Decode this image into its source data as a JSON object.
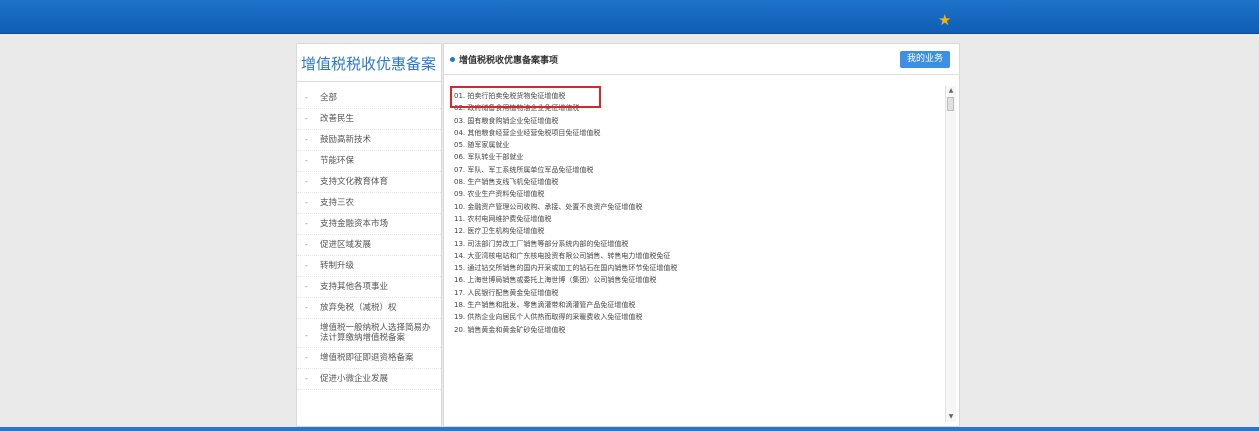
{
  "topbar": {
    "star_icon": "star-icon",
    "accent": "#1e72c8"
  },
  "left_panel": {
    "title": "增值税税收优惠备案",
    "items": [
      "全部",
      "改善民生",
      "鼓励高新技术",
      "节能环保",
      "支持文化教育体育",
      "支持三农",
      "支持金融资本市场",
      "促进区域发展",
      "转制升级",
      "支持其他各项事业",
      "放弃免税（减税）权",
      "增值税一般纳税人选择简易办法计算缴纳增值税备案",
      "增值税即征即退资格备案",
      "促进小微企业发展"
    ]
  },
  "right_panel": {
    "title": "增值税税收优惠备案事项",
    "my_business_label": "我的业务",
    "items": [
      "01. 拍卖行拍卖免税货物免征增值税",
      "02. 政府储备食用植物油企业免征增值税",
      "03. 国有粮食购销企业免征增值税",
      "04. 其他粮食经营企业经营免税项目免征增值税",
      "05. 随军家属就业",
      "06. 军队转业干部就业",
      "07. 军队、军工系统所属单位军品免征增值税",
      "08. 生产销售支线飞机免征增值税",
      "09. 农业生产资料免征增值税",
      "10. 金融资产管理公司收购、承接、处置不良资产免征增值税",
      "11. 农村电网维护费免征增值税",
      "12. 医疗卫生机构免征增值税",
      "13. 司法部门劳改工厂销售等部分系统内部的免征增值税",
      "14. 大亚湾核电站和广东核电投资有限公司销售、转售电力增值税免征",
      "15. 通过钻交所销售的国内开采或加工的钻石在国内销售环节免征增值税",
      "16. 上海世博局销售或委托上海世博（集团）公司销售免征增值税",
      "17. 人民银行配售黄金免征增值税",
      "18. 生产销售和批发、零售滴灌带和滴灌管产品免征增值税",
      "19. 供热企业向居民个人供热而取得的采暖费收入免征增值税",
      "20. 销售黄金和黄金矿砂免征增值税"
    ]
  }
}
